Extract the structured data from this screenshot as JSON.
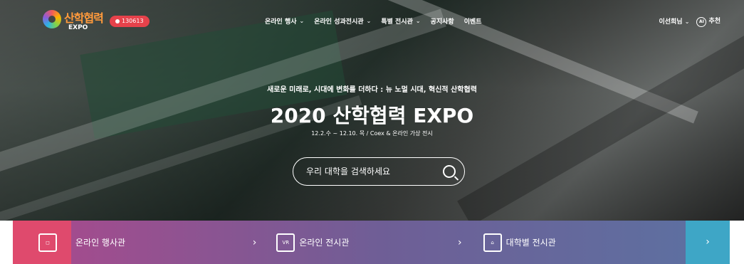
{
  "header": {
    "logo_text": "산학협력",
    "logo_sub": "EXPO",
    "visitor_count": "130613",
    "menu": [
      {
        "label": "온라인 행사"
      },
      {
        "label": "온라인 성과전시관"
      },
      {
        "label": "특별 전시관"
      },
      {
        "label": "공지사항"
      },
      {
        "label": "이벤트"
      }
    ],
    "user_label": "이선희님",
    "ai_label": "추천",
    "ai_badge": "AI"
  },
  "hero": {
    "subtitle": "새로운 미래로, 시대에 변화를 더하다 : 뉴 노멀 시대, 혁신적 산학협력",
    "title": "2020 산학협력 EXPO",
    "date": "12.2.수 ~ 12.10. 목 / Coex & 온라인 가상 전시",
    "search_placeholder": "우리 대학을 검색하세요"
  },
  "bottom": {
    "tiles": [
      {
        "label": "온라인 행사관",
        "icon": "gift-icon"
      },
      {
        "label": "온라인 전시관",
        "icon": "vr-headset-icon",
        "badge": "VR"
      },
      {
        "label": "대학별 전시관",
        "icon": "university-building-icon"
      }
    ],
    "arrow": "›"
  },
  "colors": {
    "badge_red": "#e6424b",
    "tile_left": "#df4a6d",
    "tile_right": "#3ea6c6"
  }
}
